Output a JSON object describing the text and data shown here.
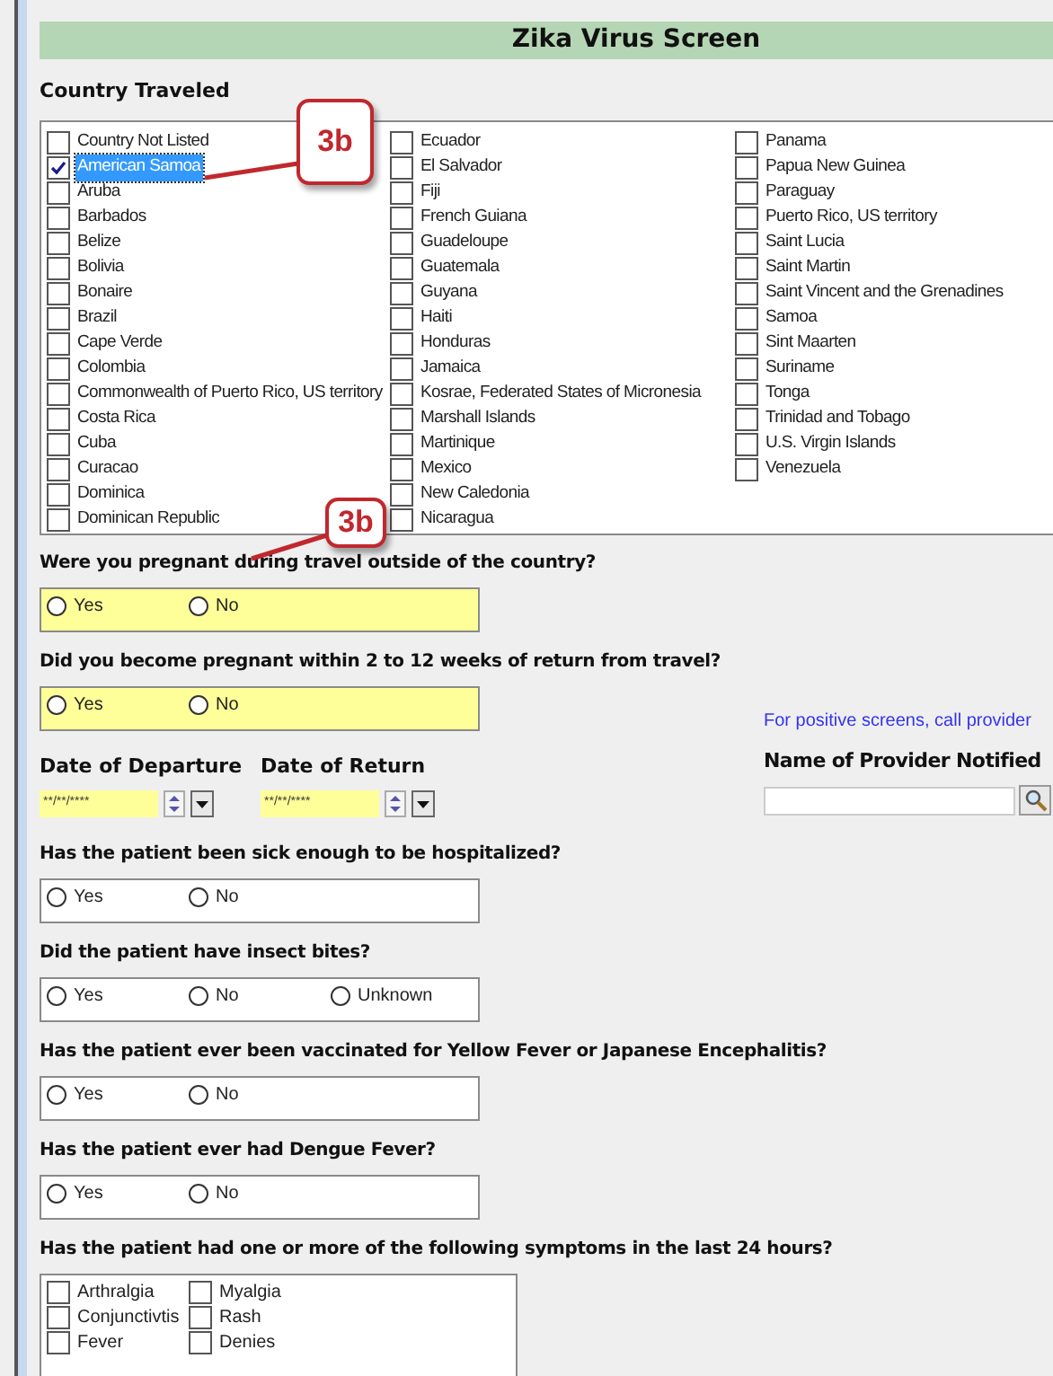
{
  "title": "Zika Virus Screen",
  "country_section": {
    "heading": "Country Traveled",
    "countries": [
      {
        "label": "Country Not Listed",
        "checked": false,
        "selected": false
      },
      {
        "label": "American Samoa",
        "checked": true,
        "selected": true
      },
      {
        "label": "Aruba",
        "checked": false,
        "selected": false
      },
      {
        "label": "Barbados",
        "checked": false,
        "selected": false
      },
      {
        "label": "Belize",
        "checked": false,
        "selected": false
      },
      {
        "label": "Bolivia",
        "checked": false,
        "selected": false
      },
      {
        "label": "Bonaire",
        "checked": false,
        "selected": false
      },
      {
        "label": "Brazil",
        "checked": false,
        "selected": false
      },
      {
        "label": "Cape Verde",
        "checked": false,
        "selected": false
      },
      {
        "label": "Colombia",
        "checked": false,
        "selected": false
      },
      {
        "label": "Commonwealth of Puerto Rico, US territory",
        "checked": false,
        "selected": false
      },
      {
        "label": "Costa Rica",
        "checked": false,
        "selected": false
      },
      {
        "label": "Cuba",
        "checked": false,
        "selected": false
      },
      {
        "label": "Curacao",
        "checked": false,
        "selected": false
      },
      {
        "label": "Dominica",
        "checked": false,
        "selected": false
      },
      {
        "label": "Dominican Republic",
        "checked": false,
        "selected": false
      },
      {
        "label": "Ecuador",
        "checked": false,
        "selected": false
      },
      {
        "label": "El Salvador",
        "checked": false,
        "selected": false
      },
      {
        "label": "Fiji",
        "checked": false,
        "selected": false
      },
      {
        "label": "French Guiana",
        "checked": false,
        "selected": false
      },
      {
        "label": "Guadeloupe",
        "checked": false,
        "selected": false
      },
      {
        "label": "Guatemala",
        "checked": false,
        "selected": false
      },
      {
        "label": "Guyana",
        "checked": false,
        "selected": false
      },
      {
        "label": "Haiti",
        "checked": false,
        "selected": false
      },
      {
        "label": "Honduras",
        "checked": false,
        "selected": false
      },
      {
        "label": "Jamaica",
        "checked": false,
        "selected": false
      },
      {
        "label": "Kosrae, Federated States of Micronesia",
        "checked": false,
        "selected": false
      },
      {
        "label": "Marshall Islands",
        "checked": false,
        "selected": false
      },
      {
        "label": "Martinique",
        "checked": false,
        "selected": false
      },
      {
        "label": "Mexico",
        "checked": false,
        "selected": false
      },
      {
        "label": "New Caledonia",
        "checked": false,
        "selected": false
      },
      {
        "label": "Nicaragua",
        "checked": false,
        "selected": false
      },
      {
        "label": "Panama",
        "checked": false,
        "selected": false
      },
      {
        "label": "Papua New Guinea",
        "checked": false,
        "selected": false
      },
      {
        "label": "Paraguay",
        "checked": false,
        "selected": false
      },
      {
        "label": "Puerto Rico, US territory",
        "checked": false,
        "selected": false
      },
      {
        "label": "Saint Lucia",
        "checked": false,
        "selected": false
      },
      {
        "label": "Saint Martin",
        "checked": false,
        "selected": false
      },
      {
        "label": "Saint Vincent and the Grenadines",
        "checked": false,
        "selected": false
      },
      {
        "label": "Samoa",
        "checked": false,
        "selected": false
      },
      {
        "label": "Sint Maarten",
        "checked": false,
        "selected": false
      },
      {
        "label": "Suriname",
        "checked": false,
        "selected": false
      },
      {
        "label": "Tonga",
        "checked": false,
        "selected": false
      },
      {
        "label": "Trinidad and Tobago",
        "checked": false,
        "selected": false
      },
      {
        "label": "U.S. Virgin Islands",
        "checked": false,
        "selected": false
      },
      {
        "label": "Venezuela",
        "checked": false,
        "selected": false
      }
    ]
  },
  "questions_top": [
    {
      "label": "Were you pregnant during travel outside of the country?",
      "kind": "radio",
      "required": true,
      "options": [
        {
          "label": "Yes",
          "selected": false
        },
        {
          "label": "No",
          "selected": false
        }
      ]
    },
    {
      "label": "Did you become pregnant within 2 to 12 weeks of return from travel?",
      "kind": "radio",
      "required": true,
      "options": [
        {
          "label": "Yes",
          "selected": false
        },
        {
          "label": "No",
          "selected": false
        }
      ]
    }
  ],
  "dates": [
    {
      "label": "Date of Departure",
      "value": "**/**/****"
    },
    {
      "label": "Date of Return",
      "value": "**/**/****"
    }
  ],
  "provider": {
    "note": "For positive screens, call provider",
    "label": "Name of Provider Notified"
  },
  "questions": [
    {
      "label": "Has the patient been sick enough to be hospitalized?",
      "kind": "radio",
      "required": false,
      "options": [
        {
          "label": "Yes",
          "selected": false
        },
        {
          "label": "No",
          "selected": false
        }
      ]
    },
    {
      "label": "Did the patient have insect bites?",
      "kind": "radio",
      "required": false,
      "options": [
        {
          "label": "Yes",
          "selected": false
        },
        {
          "label": "No",
          "selected": false
        },
        {
          "label": "Unknown",
          "selected": false
        }
      ]
    },
    {
      "label": "Has the patient ever been vaccinated for Yellow Fever or Japanese Encephalitis?",
      "kind": "radio",
      "required": false,
      "options": [
        {
          "label": "Yes",
          "selected": false
        },
        {
          "label": "No",
          "selected": false
        }
      ]
    },
    {
      "label": "Has the patient ever had Dengue Fever?",
      "kind": "radio",
      "required": false,
      "options": [
        {
          "label": "Yes",
          "selected": false
        },
        {
          "label": "No",
          "selected": false
        }
      ]
    },
    {
      "label": "Has the patient had one or more of the following symptoms in the last 24 hours?",
      "kind": "checklist",
      "required": false,
      "options": [
        {
          "label": "Arthralgia",
          "checked": false
        },
        {
          "label": "Conjunctivtis",
          "checked": false
        },
        {
          "label": "Fever",
          "checked": false
        },
        {
          "label": "Myalgia",
          "checked": false
        },
        {
          "label": "Rash",
          "checked": false
        },
        {
          "label": "Denies",
          "checked": false
        }
      ]
    }
  ],
  "callouts": [
    {
      "text": "3b"
    },
    {
      "text": "3b"
    }
  ]
}
